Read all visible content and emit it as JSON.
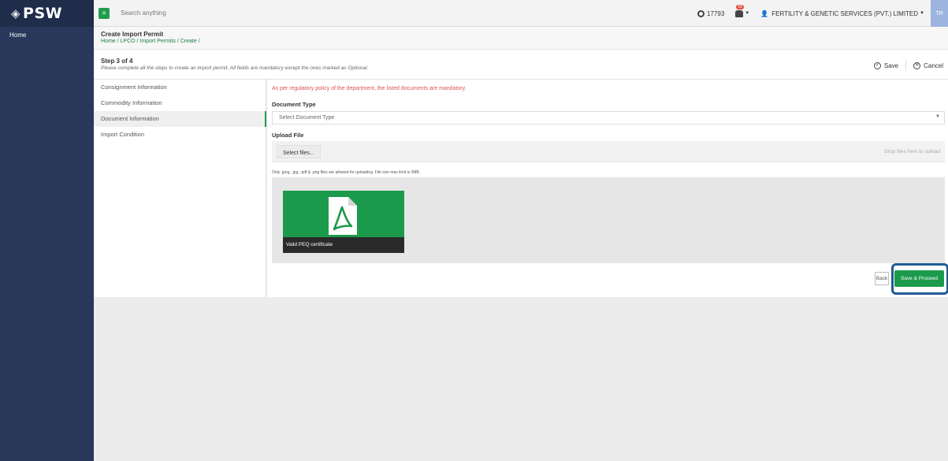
{
  "sidebar": {
    "logo_text": "PSW",
    "items": [
      {
        "label": "Home"
      }
    ]
  },
  "topbar": {
    "search_placeholder": "Search anything",
    "balance": "17793",
    "notification_badge": "99",
    "user_name": "FERTILITY & GENETIC SERVICES (PVT.) LIMITED",
    "avatar_initials": "TR"
  },
  "page": {
    "title": "Create Import Permit",
    "breadcrumb": "Home / LPCO / Import Permits / Create /"
  },
  "step": {
    "title": "Step 3 of 4",
    "subtitle": "Please complete all the steps to create an import permit. All fields are mandatory except the ones marked as Optional.",
    "save_label": "Save",
    "cancel_label": "Cancel"
  },
  "steps_nav": [
    {
      "label": "Consignment Information"
    },
    {
      "label": "Commodity Information"
    },
    {
      "label": "Document Information"
    },
    {
      "label": "Import Condition"
    }
  ],
  "form": {
    "notice": "As per regulatory policy of the department, the listed documents are mandatory.",
    "document_type_label": "Document Type",
    "document_type_placeholder": "Select Document Type",
    "upload_label": "Upload File",
    "select_files_label": "Select files...",
    "drop_hint": "Drop files here to upload",
    "file_hint": "Only .jpeg, .jpg, .pdf & .png files are allowed for uploading. File size max limit is 2MB.",
    "documents": [
      {
        "caption": "Valid PEQ certificate",
        "icon": "pdf-icon"
      }
    ],
    "back_label": "Back",
    "save_proceed_label": "Save & Proceed"
  },
  "colors": {
    "sidebar": "#27385a",
    "accent_green": "#1c9a4c",
    "highlight_border": "#1f5b96",
    "notice_red": "#d9534f"
  }
}
